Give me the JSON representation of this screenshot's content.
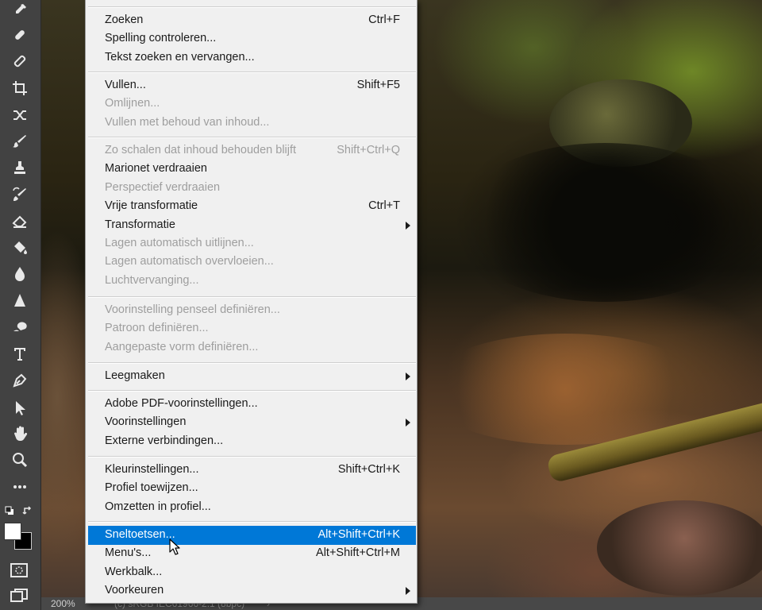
{
  "menu": {
    "groups": [
      [
        {
          "label": "Zoeken",
          "shortcut": "Ctrl+F"
        },
        {
          "label": "Spelling controleren...",
          "shortcut": ""
        },
        {
          "label": "Tekst zoeken en vervangen...",
          "shortcut": ""
        }
      ],
      [
        {
          "label": "Vullen...",
          "shortcut": "Shift+F5"
        },
        {
          "label": "Omlijnen...",
          "shortcut": ""
        },
        {
          "label": "Vullen met behoud van inhoud...",
          "shortcut": ""
        }
      ],
      [
        {
          "label": "Zo schalen dat inhoud behouden blijft",
          "shortcut": "Shift+Ctrl+Q"
        },
        {
          "label": "Marionet verdraaien",
          "shortcut": ""
        },
        {
          "label": "Perspectief verdraaien",
          "shortcut": ""
        },
        {
          "label": "Vrije transformatie",
          "shortcut": "Ctrl+T"
        },
        {
          "label": "Transformatie",
          "shortcut": ""
        },
        {
          "label": "Lagen automatisch uitlijnen...",
          "shortcut": ""
        },
        {
          "label": "Lagen automatisch overvloeien...",
          "shortcut": ""
        },
        {
          "label": "Luchtvervanging...",
          "shortcut": ""
        }
      ],
      [
        {
          "label": "Voorinstelling penseel definiëren...",
          "shortcut": ""
        },
        {
          "label": "Patroon definiëren...",
          "shortcut": ""
        },
        {
          "label": "Aangepaste vorm definiëren...",
          "shortcut": ""
        }
      ],
      [
        {
          "label": "Leegmaken",
          "shortcut": ""
        }
      ],
      [
        {
          "label": "Adobe PDF-voorinstellingen...",
          "shortcut": ""
        },
        {
          "label": "Voorinstellingen",
          "shortcut": ""
        },
        {
          "label": "Externe verbindingen...",
          "shortcut": ""
        }
      ],
      [
        {
          "label": "Kleurinstellingen...",
          "shortcut": "Shift+Ctrl+K"
        },
        {
          "label": "Profiel toewijzen...",
          "shortcut": ""
        },
        {
          "label": "Omzetten in profiel...",
          "shortcut": ""
        }
      ],
      [
        {
          "label": "Sneltoetsen...",
          "shortcut": "Alt+Shift+Ctrl+K"
        },
        {
          "label": "Menu's...",
          "shortcut": "Alt+Shift+Ctrl+M"
        },
        {
          "label": "Werkbalk...",
          "shortcut": ""
        },
        {
          "label": "Voorkeuren",
          "shortcut": ""
        }
      ]
    ],
    "highlight_color": "#0078d7",
    "disabled_color": "#9e9e9e"
  },
  "statusbar": {
    "zoom": "200%",
    "profile": "(c) sRGB IEC61966-2.1 (8bpc)",
    "arrow": "›"
  },
  "toolbar": {
    "tools": [
      "eyedropper-icon",
      "healing-brush-icon",
      "patch-icon",
      "crop-icon",
      "swap-icon",
      "brush-icon",
      "stamp-icon",
      "history-brush-icon",
      "eraser-icon",
      "paint-bucket-icon",
      "blur-icon",
      "sharpen-icon",
      "dodge-icon",
      "type-icon",
      "pen-icon",
      "path-selection-icon",
      "hand-icon",
      "zoom-icon",
      "more-icon"
    ]
  }
}
